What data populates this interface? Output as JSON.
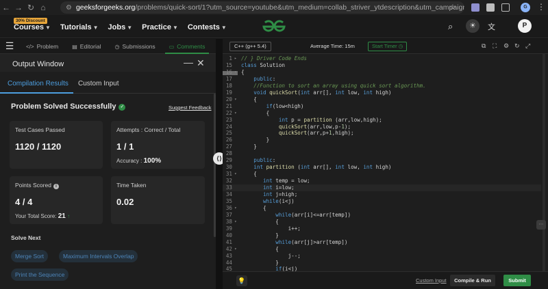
{
  "browser": {
    "url_host": "geeksforgeeks.org",
    "url_rest": "/problems/quick-sort/1?utm_source=youtube&utm_medium=collab_striver_ytdescription&utm_campaign=quick-sort",
    "profile_initial": "G"
  },
  "header": {
    "discount_badge": "30% Discount",
    "nav": [
      "Courses",
      "Tutorials",
      "Jobs",
      "Practice",
      "Contests"
    ],
    "avatar_initial": "P",
    "brand_color": "#2f8d46"
  },
  "problem_tabs": [
    {
      "label": "Problem",
      "icon": "</>"
    },
    {
      "label": "Editorial",
      "icon": "▤"
    },
    {
      "label": "Submissions",
      "icon": "◷"
    },
    {
      "label": "Comments",
      "icon": "▭"
    }
  ],
  "output": {
    "title": "Output Window",
    "tabs": [
      "Compilation Results",
      "Custom Input"
    ],
    "status": "Problem Solved Successfully",
    "feedback": "Suggest Feedback",
    "cards": {
      "test_cases": {
        "label": "Test Cases Passed",
        "value": "1120 / 1120"
      },
      "attempts": {
        "label": "Attempts : Correct / Total",
        "value": "1 / 1",
        "sub_label": "Accuracy :",
        "sub_value": "100%"
      },
      "points": {
        "label": "Points Scored",
        "value": "4 / 4",
        "sub_label": "Your Total Score:",
        "sub_value": "21"
      },
      "time": {
        "label": "Time Taken",
        "value": "0.02"
      }
    },
    "solve_next_title": "Solve Next",
    "solve_next": [
      "Merge Sort",
      "Maximum Intervals Overlap",
      "Print the Sequence"
    ]
  },
  "editor": {
    "language": "C++ (g++ 5.4)",
    "avg_time": "Average Time: 15m",
    "timer": "Start Timer",
    "custom_input": "Custom Input",
    "compile_run": "Compile & Run",
    "submit": "Submit",
    "lines": [
      {
        "n": "1",
        "fold": "▸",
        "text": "// } Driver Code Ends"
      },
      {
        "n": "15",
        "fold": "",
        "text": "class Solution"
      },
      {
        "n": "16",
        "fold": "▾",
        "text": "{"
      },
      {
        "n": "17",
        "fold": "",
        "text": "    public:"
      },
      {
        "n": "18",
        "fold": "",
        "text": "    //Function to sort an array using quick sort algorithm."
      },
      {
        "n": "19",
        "fold": "",
        "text": "    void quickSort(int arr[], int low, int high)"
      },
      {
        "n": "20",
        "fold": "▾",
        "text": "    {"
      },
      {
        "n": "21",
        "fold": "",
        "text": "        if(low<high)"
      },
      {
        "n": "22",
        "fold": "▾",
        "text": "        {"
      },
      {
        "n": "23",
        "fold": "",
        "text": "            int p = partition (arr,low,high);"
      },
      {
        "n": "24",
        "fold": "",
        "text": "            quickSort(arr,low,p-1);"
      },
      {
        "n": "25",
        "fold": "",
        "text": "            quickSort(arr,p+1,high);"
      },
      {
        "n": "26",
        "fold": "",
        "text": "        }"
      },
      {
        "n": "27",
        "fold": "",
        "text": "    }"
      },
      {
        "n": "28",
        "fold": "",
        "text": ""
      },
      {
        "n": "29",
        "fold": "",
        "text": "    public:"
      },
      {
        "n": "30",
        "fold": "",
        "text": "    int partition (int arr[], int low, int high)"
      },
      {
        "n": "31",
        "fold": "▾",
        "text": "    {"
      },
      {
        "n": "32",
        "fold": "",
        "text": "       int temp = low;"
      },
      {
        "n": "33",
        "fold": "",
        "text": "       int i=low;"
      },
      {
        "n": "34",
        "fold": "",
        "text": "       int j=high;"
      },
      {
        "n": "35",
        "fold": "",
        "text": "       while(i<j)"
      },
      {
        "n": "36",
        "fold": "▾",
        "text": "       {"
      },
      {
        "n": "37",
        "fold": "",
        "text": "           while(arr[i]<=arr[temp])"
      },
      {
        "n": "38",
        "fold": "▾",
        "text": "           {"
      },
      {
        "n": "39",
        "fold": "",
        "text": "               i++;"
      },
      {
        "n": "40",
        "fold": "",
        "text": "           }"
      },
      {
        "n": "41",
        "fold": "",
        "text": "           while(arr[j]>arr[temp])"
      },
      {
        "n": "42",
        "fold": "▾",
        "text": "           {"
      },
      {
        "n": "43",
        "fold": "",
        "text": "               j--;"
      },
      {
        "n": "44",
        "fold": "",
        "text": "           }"
      },
      {
        "n": "45",
        "fold": "",
        "text": "           if(i<j)"
      }
    ]
  }
}
